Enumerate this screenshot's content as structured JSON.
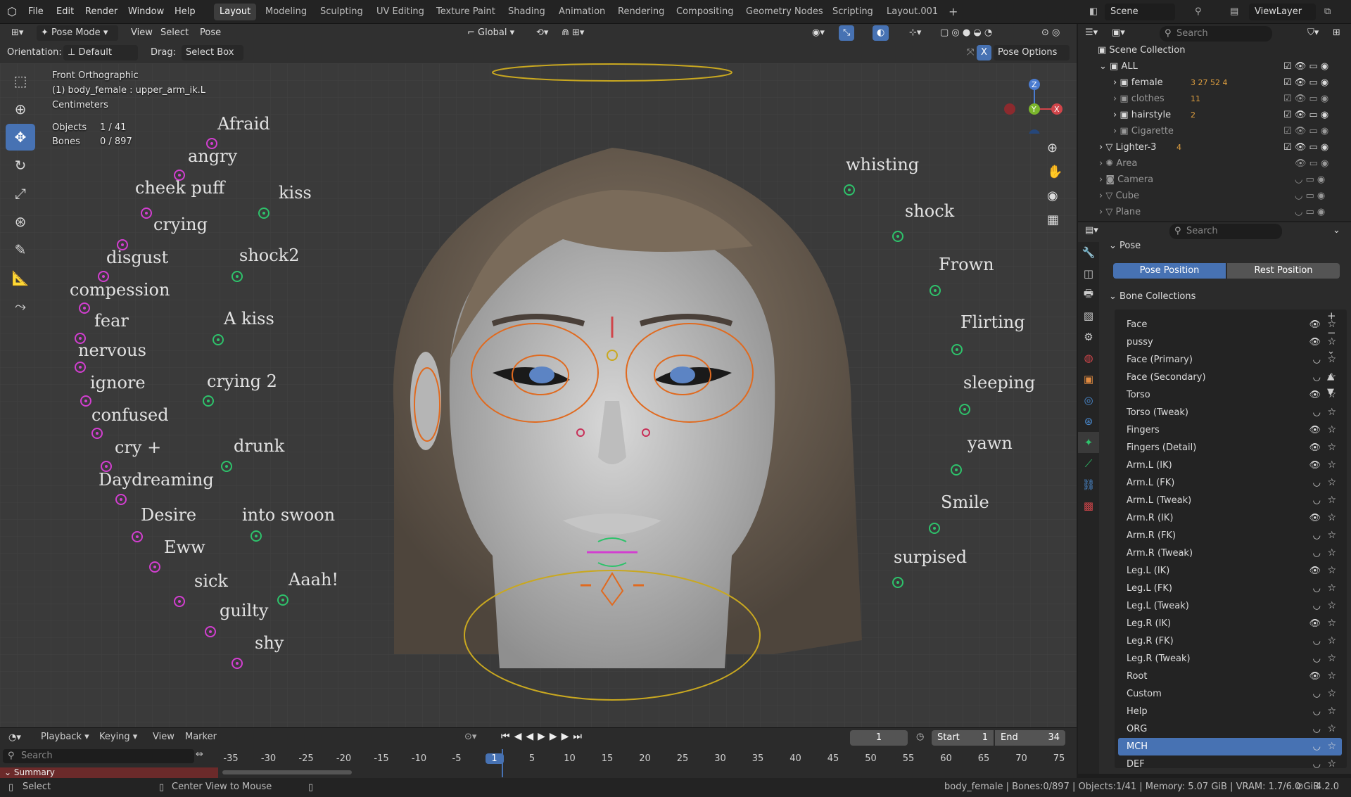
{
  "topbar": {
    "menus": [
      "File",
      "Edit",
      "Render",
      "Window",
      "Help"
    ],
    "workspaces": [
      "Layout",
      "Modeling",
      "Sculpting",
      "UV Editing",
      "Texture Paint",
      "Shading",
      "Animation",
      "Rendering",
      "Compositing",
      "Geometry Nodes",
      "Scripting",
      "Layout.001"
    ],
    "add": "+",
    "scene": "Scene",
    "viewlayer": "ViewLayer"
  },
  "header": {
    "mode": "Pose Mode",
    "menus": [
      "View",
      "Select",
      "Pose"
    ],
    "orientation_label": "Orientation:",
    "orientation_value": "Default",
    "drag_label": "Drag:",
    "drag_value": "Select Box",
    "transform": "Global",
    "pose_options": "Pose Options"
  },
  "viewport": {
    "view_name": "Front Orthographic",
    "object": "(1) body_female : upper_arm_ik.L",
    "units": "Centimeters",
    "objects_label": "Objects",
    "objects_value": "1 / 41",
    "bones_label": "Bones",
    "bones_value": "0 / 897",
    "left_labels": [
      "Afraid",
      "angry",
      "cheek puff",
      "crying",
      "disgust",
      "compession",
      "fear",
      "nervous",
      "ignore",
      "confused",
      "cry +",
      "Daydreaming",
      "Desire",
      "Eww",
      "sick",
      "guilty",
      "shy"
    ],
    "mid_labels": [
      "kiss",
      "shock2",
      "A kiss",
      "crying 2",
      "drunk",
      "into swoon",
      "Aaah!"
    ],
    "right_labels": [
      "whisting",
      "shock",
      "Frown",
      "Flirting",
      "sleeping",
      "yawn",
      "Smile",
      "surpised"
    ]
  },
  "outliner": {
    "search_placeholder": "Search",
    "root": "Scene Collection",
    "rows": [
      {
        "name": "ALL"
      },
      {
        "name": "female",
        "badges": "3 27 52 4"
      },
      {
        "name": "clothes",
        "badges": "11"
      },
      {
        "name": "hairstyle",
        "badges": "2"
      },
      {
        "name": "Cigarette",
        "badges": ""
      },
      {
        "name": "Lighter-3",
        "badges": "4"
      },
      {
        "name": "Area",
        "badges": ""
      },
      {
        "name": "Camera",
        "badges": ""
      },
      {
        "name": "Cube",
        "badges": ""
      },
      {
        "name": "Plane",
        "badges": ""
      }
    ]
  },
  "properties": {
    "search_placeholder": "Search",
    "pose_section": "Pose",
    "pose_position": "Pose Position",
    "rest_position": "Rest Position",
    "bone_collections_title": "Bone Collections",
    "collections": [
      {
        "name": "Face",
        "visible": true
      },
      {
        "name": "pussy",
        "visible": true
      },
      {
        "name": "Face (Primary)",
        "visible": false
      },
      {
        "name": "Face (Secondary)",
        "visible": false
      },
      {
        "name": "Torso",
        "visible": true
      },
      {
        "name": "Torso (Tweak)",
        "visible": false
      },
      {
        "name": "Fingers",
        "visible": true
      },
      {
        "name": "Fingers (Detail)",
        "visible": true
      },
      {
        "name": "Arm.L (IK)",
        "visible": true
      },
      {
        "name": "Arm.L (FK)",
        "visible": false
      },
      {
        "name": "Arm.L (Tweak)",
        "visible": false
      },
      {
        "name": "Arm.R (IK)",
        "visible": true
      },
      {
        "name": "Arm.R (FK)",
        "visible": false
      },
      {
        "name": "Arm.R (Tweak)",
        "visible": false
      },
      {
        "name": "Leg.L (IK)",
        "visible": true
      },
      {
        "name": "Leg.L (FK)",
        "visible": false
      },
      {
        "name": "Leg.L (Tweak)",
        "visible": false
      },
      {
        "name": "Leg.R (IK)",
        "visible": true
      },
      {
        "name": "Leg.R (FK)",
        "visible": false
      },
      {
        "name": "Leg.R (Tweak)",
        "visible": false
      },
      {
        "name": "Root",
        "visible": true
      },
      {
        "name": "Custom",
        "visible": false
      },
      {
        "name": "Help",
        "visible": false
      },
      {
        "name": "ORG",
        "visible": false
      },
      {
        "name": "MCH",
        "visible": false
      },
      {
        "name": "DEF",
        "visible": false
      }
    ],
    "selected": "MCH"
  },
  "timeline": {
    "menus": [
      "Playback",
      "Keying",
      "View",
      "Marker"
    ],
    "current_frame": "1",
    "start_label": "Start",
    "start": "1",
    "end_label": "End",
    "end": "34",
    "search_placeholder": "Search",
    "ticks": [
      "-35",
      "-30",
      "-25",
      "-20",
      "-15",
      "-10",
      "-5",
      "1",
      "5",
      "10",
      "15",
      "20",
      "25",
      "30",
      "35",
      "40",
      "45",
      "50",
      "55",
      "60",
      "65",
      "70",
      "75"
    ],
    "summary": "Summary"
  },
  "status": {
    "select": "Select",
    "center": "Center View to Mouse",
    "info": "body_female | Bones:0/897 | Objects:1/41 | Memory: 5.07 GiB | VRAM: 1.7/6.0 GiB",
    "version": "4.2.0"
  },
  "colors": {
    "accent": "#4772b3",
    "magenta": "#d23fd0",
    "green": "#2ec26b",
    "orange": "#e06a1f"
  }
}
